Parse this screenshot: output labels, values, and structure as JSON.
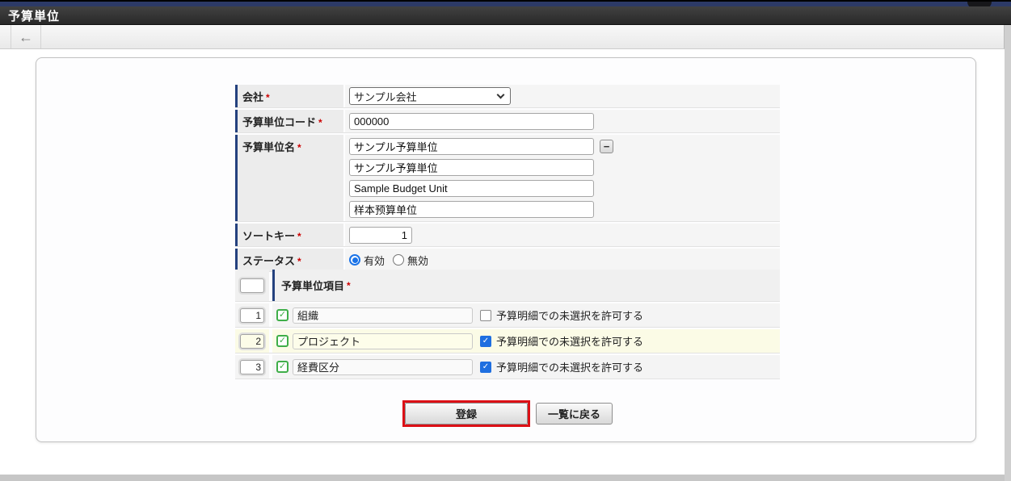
{
  "header": {
    "title": "予算単位"
  },
  "icons": {
    "back": "←",
    "minus": "−",
    "check": "✓"
  },
  "form": {
    "rows": [
      {
        "label": "会社",
        "required": "*",
        "value": "サンプル会社"
      },
      {
        "label": "予算単位コード",
        "required": "*",
        "value": "000000"
      },
      {
        "label": "予算単位名",
        "required": "*",
        "values": [
          "サンプル予算単位",
          "サンプル予算単位",
          "Sample Budget Unit",
          "样本预算单位"
        ]
      },
      {
        "label": "ソートキー",
        "required": "*",
        "value": "1"
      },
      {
        "label": "ステータス",
        "required": "*",
        "options": [
          {
            "label": "有効",
            "selected": true
          },
          {
            "label": "無効",
            "selected": false
          }
        ]
      }
    ]
  },
  "items_table": {
    "header_label": "予算単位項目",
    "required": "*",
    "allow_label": "予算明細での未選択を許可する",
    "rows": [
      {
        "index": "1",
        "enabled": true,
        "name": "組織",
        "allow_unselected": false,
        "highlight": false
      },
      {
        "index": "2",
        "enabled": true,
        "name": "プロジェクト",
        "allow_unselected": true,
        "highlight": true
      },
      {
        "index": "3",
        "enabled": true,
        "name": "経費区分",
        "allow_unselected": true,
        "highlight": false
      }
    ]
  },
  "actions": {
    "submit_label": "登録",
    "back_label": "一覧に戻る"
  },
  "colors": {
    "navy_strip": "#2c3a67",
    "label_accent": "#24417e",
    "required_red": "#cc0000",
    "annotation_red": "#dc1016",
    "radio_blue": "#1a73e8",
    "check_green": "#3fae49",
    "checkbox_blue": "#1f6fe0",
    "row_highlight": "#fbfbe6"
  }
}
